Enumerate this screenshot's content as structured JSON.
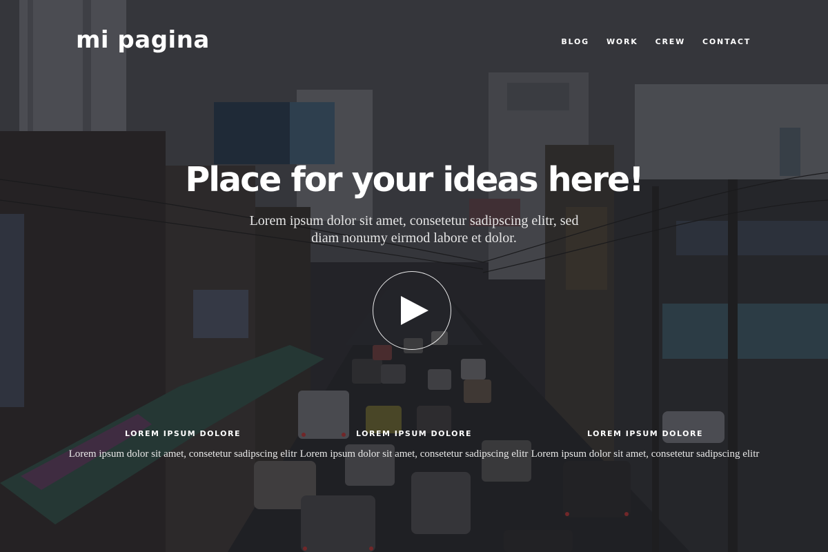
{
  "brand": {
    "name": "mi pagina"
  },
  "nav": {
    "items": [
      {
        "label": "BLOG"
      },
      {
        "label": "WORK"
      },
      {
        "label": "CREW"
      },
      {
        "label": "CONTACT"
      }
    ]
  },
  "hero": {
    "headline": "Place for your ideas here!",
    "lead": "Lorem ipsum dolor sit amet, consetetur sadipscing elitr, sed diam nonumy eirmod labore et dolor.",
    "play_icon": "play-icon",
    "background_image": "city street with traffic, dark overlay"
  },
  "features": [
    {
      "title": "LOREM IPSUM DOLORE",
      "text": "Lorem ipsum dolor sit amet, consetetur sadipscing elitr"
    },
    {
      "title": "LOREM IPSUM DOLORE",
      "text": "Lorem ipsum dolor sit amet, consetetur sadipscing elitr"
    },
    {
      "title": "LOREM IPSUM DOLORE",
      "text": "Lorem ipsum dolor sit amet, consetetur sadipscing elitr"
    }
  ],
  "colors": {
    "text": "#ffffff",
    "overlay": "#141419"
  }
}
